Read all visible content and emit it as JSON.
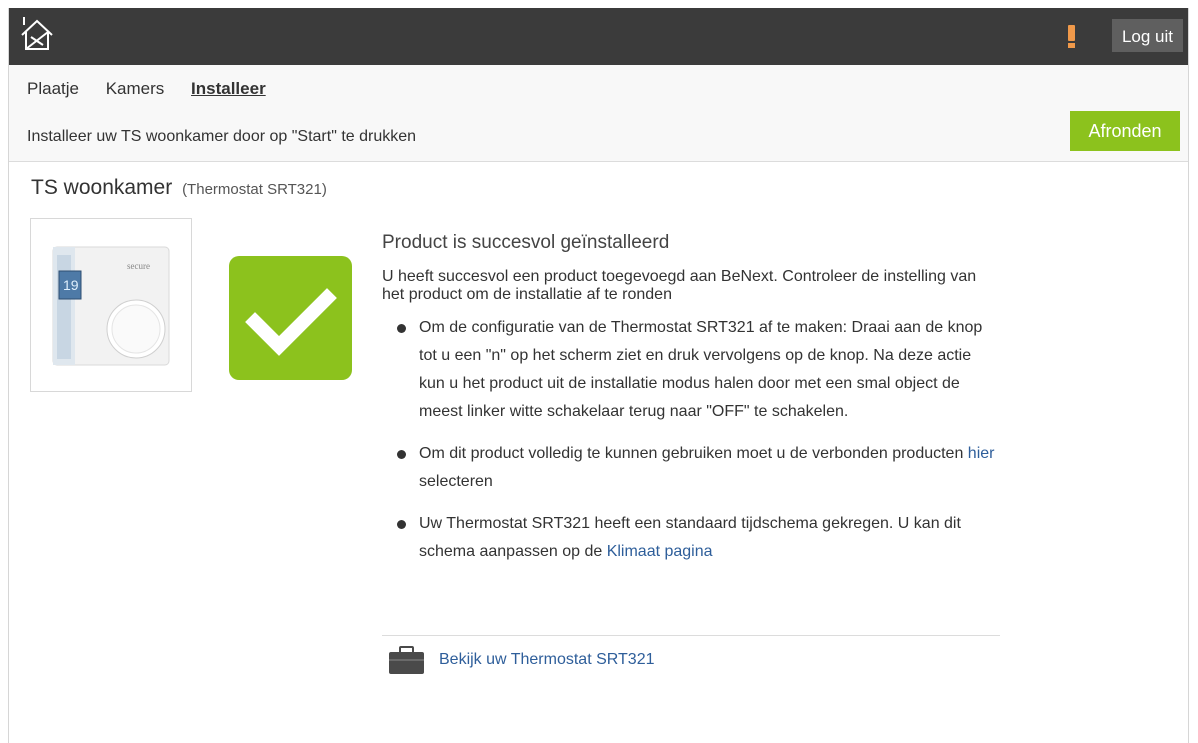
{
  "header": {
    "logo_icon": "house-logo-icon",
    "alert_icon": "exclamation-icon",
    "alert_color": "#f0994a",
    "logout_label": "Log uit"
  },
  "nav": {
    "tabs": [
      {
        "label": "Plaatje",
        "active": false
      },
      {
        "label": "Kamers",
        "active": false
      },
      {
        "label": "Installeer",
        "active": true
      }
    ]
  },
  "toolbar": {
    "instruction": "Installeer uw TS woonkamer door op \"Start\" te drukken",
    "finish_label": "Afronden",
    "finish_color": "#8cc21d"
  },
  "device": {
    "name": "TS woonkamer",
    "model": "(Thermostat SRT321)",
    "display_value": "19",
    "brand": "secure"
  },
  "status": {
    "icon": "checkmark-icon",
    "color": "#8cc21d",
    "heading": "Product is succesvol geïnstalleerd",
    "intro": "U heeft succesvol een product toegevoegd aan BeNext. Controleer de instelling van het product om de installatie af te ronden",
    "item1": "Om de configuratie van de Thermostat SRT321 af te maken: Draai aan de knop tot u een \"n\" op het scherm ziet en druk vervolgens op de knop. Na deze actie kun u het product uit de installatie modus halen door met een smal object de meest linker witte schakelaar terug naar \"OFF\" te schakelen.",
    "item2_before": "Om dit product volledig te kunnen gebruiken moet u de verbonden producten ",
    "item2_link": "hier",
    "item2_after": " selecteren",
    "item3_before": "Uw Thermostat SRT321 heeft een standaard tijdschema gekregen. U kan dit schema aanpassen op de ",
    "item3_link": "Klimaat pagina"
  },
  "footer_link": {
    "icon": "briefcase-icon",
    "label": "Bekijk uw Thermostat SRT321"
  }
}
